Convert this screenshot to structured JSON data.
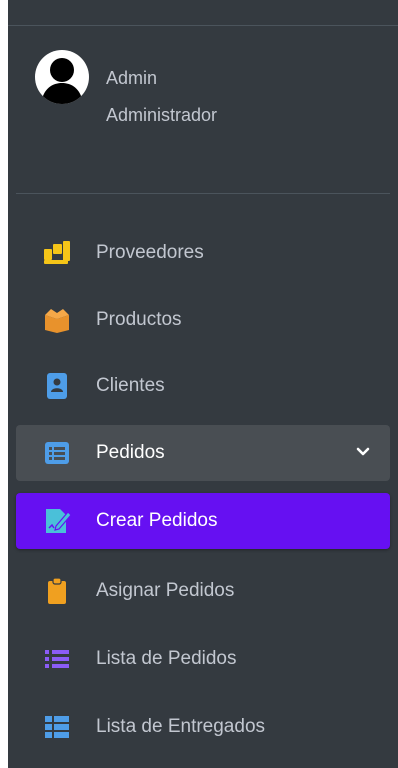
{
  "user": {
    "name": "Admin",
    "role": "Administrador"
  },
  "nav": {
    "items": [
      {
        "label": "Proveedores",
        "icon": "people-carry-icon",
        "color": "#f5c518"
      },
      {
        "label": "Productos",
        "icon": "box-open-icon",
        "color": "#e8922c"
      },
      {
        "label": "Clientes",
        "icon": "address-book-icon",
        "color": "#4e9de8"
      },
      {
        "label": "Pedidos",
        "icon": "list-alt-icon",
        "color": "#4e9de8",
        "state": "expanded"
      },
      {
        "label": "Crear Pedidos",
        "icon": "file-signature-icon",
        "color": "#4ac0d9",
        "state": "active"
      },
      {
        "label": "Asignar Pedidos",
        "icon": "clipboard-icon",
        "color": "#f0a020"
      },
      {
        "label": "Lista de Pedidos",
        "icon": "list-icon",
        "color": "#8b5cf6"
      },
      {
        "label": "Lista de Entregados",
        "icon": "th-list-icon",
        "color": "#4e9de8"
      }
    ]
  },
  "colors": {
    "sidebar_bg": "#343a40",
    "open_bg": "#494e53",
    "active_bg": "#6610f2",
    "text": "#c2c7d0"
  }
}
